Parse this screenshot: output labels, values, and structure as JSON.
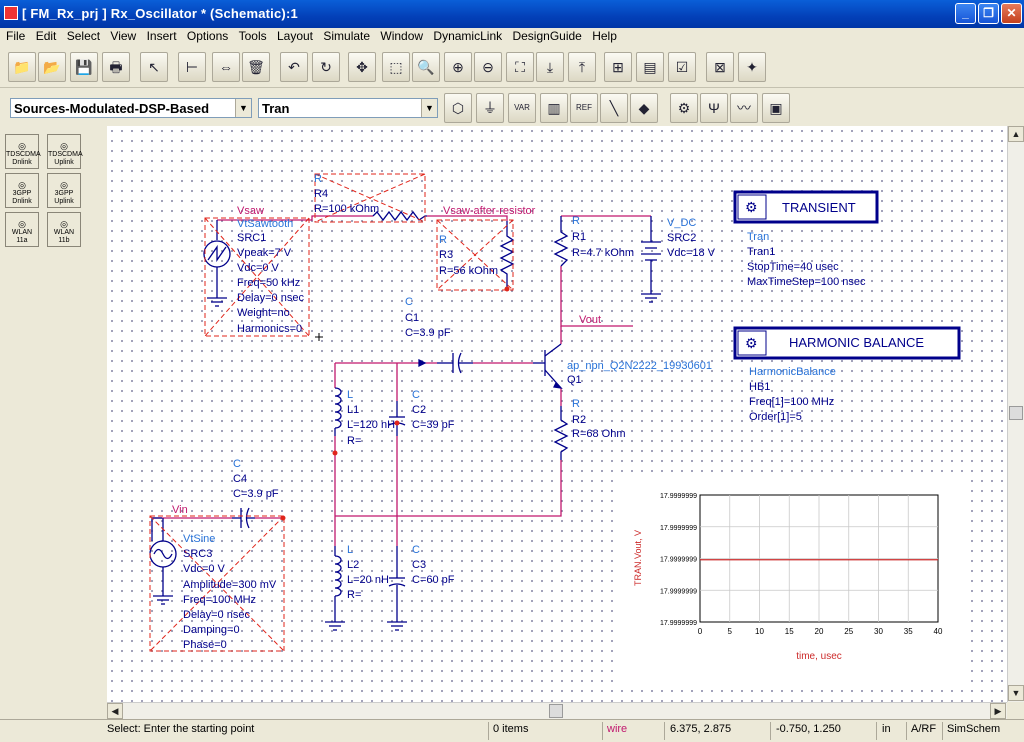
{
  "window": {
    "title": "[ FM_Rx_prj ] Rx_Oscillator * (Schematic):1"
  },
  "menu": [
    "File",
    "Edit",
    "Select",
    "View",
    "Insert",
    "Options",
    "Tools",
    "Layout",
    "Simulate",
    "Window",
    "DynamicLink",
    "DesignGuide",
    "Help"
  ],
  "toolbar": {
    "palette_select": "Sources-Modulated-DSP-Based",
    "component_select": "Tran",
    "buttons1": [
      "open-folder-icon",
      "open-file-icon",
      "save-icon",
      "print-icon",
      "select-pointer-icon",
      "insert-component-icon",
      "mirror-icon",
      "delete-icon",
      "undo-icon",
      "rotate-icon",
      "move-icon",
      "zoom-area-icon",
      "zoom-icon",
      "zoom-in-icon",
      "zoom-out-icon",
      "view-all-icon",
      "push-into-icon",
      "pop-out-icon",
      "place-icon",
      "flatten-icon",
      "design-check-icon",
      "deactivate-icon",
      "wand-icon"
    ],
    "buttons2": [
      "port-icon",
      "ground-icon",
      "var-icon",
      "component-icon",
      "ref-icon",
      "wire-icon",
      "name-icon",
      "simulate-icon",
      "tune-icon",
      "data-display-icon",
      "save-sim-icon"
    ]
  },
  "palette": [
    {
      "icon": "tdscdma-dnlink-icon",
      "l1": "TDSCDMA",
      "l2": "Dnlink"
    },
    {
      "icon": "tdscdma-uplink-icon",
      "l1": "TDSCDMA",
      "l2": "Uplink"
    },
    {
      "icon": "3gpp-dnlink-icon",
      "l1": "3GPP",
      "l2": "Dnlink"
    },
    {
      "icon": "3gpp-uplink-icon",
      "l1": "3GPP",
      "l2": "Uplink"
    },
    {
      "icon": "wlan-11a-icon",
      "l1": "WLAN",
      "l2": "11a"
    },
    {
      "icon": "wlan-11b-icon",
      "l1": "WLAN",
      "l2": "11b"
    }
  ],
  "schematic": {
    "colors": {
      "wire": "#c0186e",
      "component": "#00008b",
      "label": "#2872d8",
      "deactivated": "#e0251b"
    },
    "src1": [
      "Vsaw",
      "VtSawtooth",
      "SRC1",
      "Vpeak=7 V",
      "Vdc=0 V",
      "Freq=50 kHz",
      "Delay=0 nsec",
      "Weight=no",
      "Harmonics=0"
    ],
    "r4": [
      "R",
      "R4",
      "R=100 kOhm"
    ],
    "net_vsaw_after": "Vsaw-after-resistor",
    "r3": [
      "R",
      "R3",
      "R=56 kOhm"
    ],
    "r1": [
      "R",
      "R1",
      "R=4.7 kOhm"
    ],
    "vdc": [
      "V_DC",
      "SRC2",
      "Vdc=18 V"
    ],
    "c1": [
      "C",
      "C1",
      "C=3.9 pF"
    ],
    "net_vout": "Vout",
    "q1": [
      "ap_npn_Q2N2222_19930601",
      "Q1"
    ],
    "r2": [
      "R",
      "R2",
      "R=68 Ohm"
    ],
    "l1": [
      "L",
      "L1",
      "L=120 nH",
      "R="
    ],
    "c2": [
      "C",
      "C2",
      "C=39 pF"
    ],
    "c4": [
      "C",
      "C4",
      "C=3.9 pF"
    ],
    "vin": "Vin",
    "src3": [
      "VtSine",
      "SRC3",
      "Vdc=0 V",
      "Amplitude=300 mV",
      "Freq=100 MHz",
      "Delay=0 nsec",
      "Damping=0",
      "Phase=0"
    ],
    "l2": [
      "L",
      "L2",
      "L=20 nH",
      "R="
    ],
    "c3": [
      "C",
      "C3",
      "C=60 pF"
    ],
    "tran": {
      "header": "TRANSIENT",
      "lines": [
        "Tran",
        "Tran1",
        "StopTime=40 usec",
        "MaxTimeStep=100 nsec"
      ]
    },
    "hb": {
      "header": "HARMONIC BALANCE",
      "lines": [
        "HarmonicBalance",
        "HB1",
        "Freq[1]=100 MHz",
        "Order[1]=5"
      ]
    }
  },
  "chart_data": {
    "type": "line",
    "xlabel": "time, usec",
    "ylabel": "TRAN.Vout, V",
    "xticks": [
      "0",
      "5",
      "10",
      "15",
      "20",
      "25",
      "30",
      "35",
      "40"
    ],
    "yticks": [
      "17.9999999",
      "17.9999999",
      "17.9999999",
      "17.9999999",
      "17.9999999"
    ],
    "xlim": [
      0,
      40
    ],
    "series": [
      {
        "color": "#cc2a2a",
        "x": [
          0,
          40
        ],
        "y": [
          17.9999999,
          17.9999999
        ]
      }
    ]
  },
  "status": {
    "message": "Select: Enter the starting point",
    "items": "0 items",
    "mode": "wire",
    "coord1": "6.375, 2.875",
    "coord2": "-0.750, 1.250",
    "units": "in",
    "layer": "A/RF",
    "view": "SimSchem"
  }
}
